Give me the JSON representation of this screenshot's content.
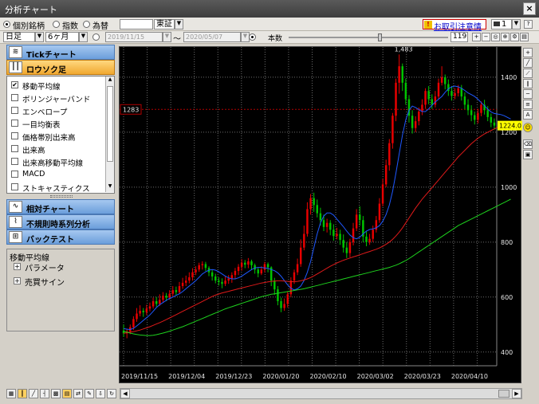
{
  "window": {
    "title": "分析チャート",
    "close_label": "×"
  },
  "toolbar": {
    "type_options": [
      "個別銘柄",
      "指数",
      "為替"
    ],
    "selected_type": "個別銘柄",
    "market": "東証",
    "notice": "お取引注意情報",
    "window_count": "1",
    "period_unit": "日足",
    "period_range": "6ヶ月",
    "date_from": "2019/11/15",
    "date_to": "2020/05/07",
    "tilde": "〜",
    "bars_label": "本数",
    "bars_value": "119"
  },
  "sidebar": {
    "sections": [
      {
        "label": "Tickチャート",
        "icon": "tick-icon"
      },
      {
        "label": "ロウソク足",
        "icon": "candle-icon",
        "active": true
      }
    ],
    "indicators": [
      {
        "label": "移動平均線",
        "checked": true
      },
      {
        "label": "ボリンジャーバンド",
        "checked": false
      },
      {
        "label": "エンベロープ",
        "checked": false
      },
      {
        "label": "一目均衡表",
        "checked": false
      },
      {
        "label": "価格帯別出来高",
        "checked": false
      },
      {
        "label": "出来高",
        "checked": false
      },
      {
        "label": "出来高移動平均線",
        "checked": false
      },
      {
        "label": "MACD",
        "checked": false
      },
      {
        "label": "ストキャスティクス",
        "checked": false
      }
    ],
    "more_sections": [
      {
        "label": "相対チャート",
        "icon": "relative-icon"
      },
      {
        "label": "不規則時系列分析",
        "icon": "irregular-icon"
      },
      {
        "label": "バックテスト",
        "icon": "backtest-icon"
      }
    ],
    "param_panel": {
      "title": "移動平均線",
      "items": [
        "パラメータ",
        "売買サイン"
      ]
    }
  },
  "chart_data": {
    "type": "candlestick",
    "y_ticks": [
      400,
      600,
      800,
      1000,
      1200,
      1400
    ],
    "ylim": [
      350,
      1510
    ],
    "x_labels": [
      "2019/11/15",
      "2019/12/04",
      "2019/12/23",
      "2020/01/20",
      "2020/02/10",
      "2020/03/02",
      "2020/03/23",
      "2020/04/10"
    ],
    "high_marker": "1,483",
    "hline_label": "1283",
    "current_price": "1224.0",
    "candles": [
      [
        478,
        468,
        500,
        455
      ],
      [
        468,
        475,
        485,
        450
      ],
      [
        475,
        490,
        500,
        465
      ],
      [
        490,
        520,
        530,
        480
      ],
      [
        520,
        540,
        560,
        510
      ],
      [
        540,
        550,
        570,
        530
      ],
      [
        550,
        545,
        560,
        528
      ],
      [
        545,
        558,
        572,
        535
      ],
      [
        558,
        566,
        580,
        548
      ],
      [
        566,
        585,
        598,
        558
      ],
      [
        585,
        575,
        600,
        565
      ],
      [
        575,
        590,
        610,
        568
      ],
      [
        590,
        605,
        618,
        580
      ],
      [
        605,
        598,
        615,
        585
      ],
      [
        598,
        612,
        625,
        590
      ],
      [
        612,
        625,
        640,
        600
      ],
      [
        625,
        618,
        638,
        605
      ],
      [
        618,
        640,
        655,
        612
      ],
      [
        640,
        652,
        670,
        630
      ],
      [
        652,
        660,
        678,
        640
      ],
      [
        660,
        672,
        690,
        650
      ],
      [
        672,
        690,
        705,
        660
      ],
      [
        690,
        700,
        712,
        680
      ],
      [
        700,
        716,
        725,
        692
      ],
      [
        716,
        720,
        730,
        700
      ],
      [
        720,
        706,
        728,
        695
      ],
      [
        706,
        690,
        712,
        676
      ],
      [
        690,
        675,
        700,
        660
      ],
      [
        675,
        660,
        685,
        650
      ],
      [
        660,
        655,
        672,
        642
      ],
      [
        655,
        648,
        668,
        632
      ],
      [
        648,
        660,
        675,
        640
      ],
      [
        660,
        668,
        680,
        648
      ],
      [
        668,
        680,
        690,
        652
      ],
      [
        680,
        695,
        706,
        665
      ],
      [
        695,
        710,
        720,
        680
      ],
      [
        710,
        725,
        738,
        696
      ],
      [
        725,
        718,
        735,
        705
      ],
      [
        718,
        730,
        742,
        705
      ],
      [
        730,
        716,
        736,
        698
      ],
      [
        716,
        700,
        722,
        685
      ],
      [
        700,
        686,
        708,
        672
      ],
      [
        686,
        700,
        712,
        680
      ],
      [
        700,
        720,
        728,
        690
      ],
      [
        720,
        708,
        726,
        690
      ],
      [
        708,
        660,
        712,
        640
      ],
      [
        660,
        628,
        670,
        608
      ],
      [
        628,
        585,
        640,
        570
      ],
      [
        585,
        560,
        598,
        545
      ],
      [
        560,
        575,
        595,
        550
      ],
      [
        575,
        610,
        620,
        562
      ],
      [
        610,
        660,
        672,
        600
      ],
      [
        660,
        690,
        700,
        648
      ],
      [
        690,
        720,
        740,
        680
      ],
      [
        720,
        780,
        810,
        710
      ],
      [
        780,
        830,
        860,
        770
      ],
      [
        830,
        920,
        945,
        820
      ],
      [
        920,
        960,
        975,
        900
      ],
      [
        960,
        935,
        980,
        910
      ],
      [
        935,
        905,
        955,
        890
      ],
      [
        905,
        880,
        925,
        860
      ],
      [
        880,
        855,
        900,
        840
      ],
      [
        855,
        870,
        885,
        835
      ],
      [
        870,
        845,
        880,
        825
      ],
      [
        845,
        822,
        865,
        805
      ],
      [
        822,
        830,
        852,
        810
      ],
      [
        830,
        808,
        845,
        790
      ],
      [
        808,
        780,
        828,
        762
      ],
      [
        780,
        760,
        800,
        742
      ],
      [
        760,
        800,
        812,
        745
      ],
      [
        800,
        850,
        870,
        788
      ],
      [
        850,
        900,
        920,
        840
      ],
      [
        900,
        880,
        930,
        860
      ],
      [
        880,
        820,
        895,
        800
      ],
      [
        820,
        800,
        840,
        785
      ],
      [
        800,
        812,
        830,
        790
      ],
      [
        812,
        845,
        860,
        800
      ],
      [
        845,
        880,
        895,
        835
      ],
      [
        880,
        940,
        960,
        870
      ],
      [
        940,
        1010,
        1030,
        930
      ],
      [
        1010,
        1080,
        1100,
        1000
      ],
      [
        1080,
        1160,
        1175,
        1060
      ],
      [
        1160,
        1260,
        1270,
        1140
      ],
      [
        1260,
        1380,
        1395,
        1240
      ],
      [
        1380,
        1440,
        1483,
        1340
      ],
      [
        1440,
        1380,
        1450,
        1350
      ],
      [
        1380,
        1320,
        1395,
        1300
      ],
      [
        1320,
        1260,
        1335,
        1235
      ],
      [
        1260,
        1215,
        1280,
        1195
      ],
      [
        1215,
        1240,
        1258,
        1200
      ],
      [
        1240,
        1275,
        1290,
        1225
      ],
      [
        1275,
        1300,
        1320,
        1262
      ],
      [
        1300,
        1350,
        1360,
        1285
      ],
      [
        1350,
        1320,
        1368,
        1302
      ],
      [
        1320,
        1300,
        1338,
        1285
      ],
      [
        1300,
        1330,
        1350,
        1290
      ],
      [
        1330,
        1380,
        1395,
        1318
      ],
      [
        1380,
        1400,
        1440,
        1370
      ],
      [
        1400,
        1375,
        1410,
        1356
      ],
      [
        1375,
        1350,
        1392,
        1332
      ],
      [
        1350,
        1332,
        1368,
        1315
      ],
      [
        1332,
        1342,
        1360,
        1320
      ],
      [
        1342,
        1360,
        1372,
        1330
      ],
      [
        1360,
        1330,
        1372,
        1315
      ],
      [
        1330,
        1300,
        1345,
        1284
      ],
      [
        1300,
        1280,
        1320,
        1262
      ],
      [
        1280,
        1262,
        1298,
        1240
      ],
      [
        1262,
        1245,
        1275,
        1228
      ],
      [
        1245,
        1270,
        1285,
        1232
      ],
      [
        1270,
        1300,
        1312,
        1258
      ],
      [
        1300,
        1280,
        1318,
        1264
      ],
      [
        1280,
        1255,
        1295,
        1240
      ],
      [
        1255,
        1235,
        1268,
        1218
      ],
      [
        1235,
        1224,
        1250,
        1210
      ]
    ],
    "series": [
      {
        "color": "#1e58ff",
        "values": [
          485,
          483,
          482,
          486,
          495,
          505,
          515,
          525,
          535,
          548,
          562,
          572,
          580,
          588,
          595,
          600,
          606,
          612,
          620,
          630,
          640,
          650,
          660,
          672,
          684,
          692,
          698,
          700,
          698,
          692,
          684,
          676,
          670,
          666,
          666,
          670,
          676,
          684,
          692,
          700,
          706,
          708,
          708,
          706,
          704,
          700,
          696,
          688,
          676,
          660,
          644,
          632,
          626,
          630,
          640,
          660,
          690,
          730,
          780,
          830,
          870,
          895,
          906,
          906,
          898,
          884,
          870,
          856,
          840,
          826,
          816,
          812,
          818,
          830,
          840,
          846,
          848,
          852,
          860,
          876,
          900,
          935,
          985,
          1050,
          1120,
          1190,
          1245,
          1280,
          1295,
          1290,
          1282,
          1275,
          1275,
          1285,
          1298,
          1310,
          1320,
          1330,
          1345,
          1358,
          1365,
          1368,
          1365,
          1360,
          1352,
          1343,
          1337,
          1330,
          1320,
          1308,
          1296,
          1284,
          1274,
          1268,
          1266,
          1264,
          1260,
          1254,
          1248
        ]
      },
      {
        "color": "#e01a1a",
        "values": [
          468,
          470,
          472,
          474,
          477,
          480,
          484,
          488,
          492,
          497,
          502,
          507,
          512,
          518,
          524,
          530,
          536,
          542,
          548,
          554,
          560,
          566,
          572,
          578,
          584,
          590,
          596,
          602,
          607,
          611,
          615,
          618,
          621,
          624,
          627,
          630,
          633,
          636,
          639,
          642,
          645,
          648,
          651,
          653,
          655,
          657,
          658,
          659,
          659,
          658,
          657,
          656,
          656,
          657,
          659,
          662,
          666,
          671,
          677,
          684,
          691,
          698,
          705,
          712,
          718,
          724,
          729,
          734,
          738,
          742,
          746,
          750,
          754,
          758,
          762,
          766,
          770,
          774,
          779,
          785,
          792,
          800,
          810,
          822,
          836,
          852,
          870,
          888,
          906,
          924,
          940,
          956,
          970,
          984,
          998,
          1012,
          1026,
          1040,
          1054,
          1068,
          1082,
          1096,
          1110,
          1122,
          1134,
          1146,
          1158,
          1168,
          1178,
          1186,
          1194,
          1200,
          1206,
          1212,
          1217,
          1222,
          1226,
          1230,
          1233
        ]
      },
      {
        "color": "#1ed21e",
        "values": [
          475,
          472,
          469,
          466,
          464,
          462,
          461,
          460,
          460,
          461,
          463,
          466,
          469,
          472,
          476,
          480,
          484,
          488,
          492,
          497,
          502,
          507,
          512,
          517,
          522,
          527,
          532,
          537,
          542,
          547,
          552,
          557,
          561,
          565,
          569,
          573,
          577,
          581,
          585,
          589,
          593,
          597,
          601,
          604,
          607,
          610,
          612,
          614,
          616,
          618,
          620,
          622,
          624,
          626,
          628,
          630,
          633,
          636,
          639,
          642,
          645,
          648,
          651,
          654,
          657,
          660,
          663,
          666,
          669,
          672,
          675,
          678,
          681,
          684,
          687,
          690,
          693,
          696,
          699,
          702,
          705,
          708,
          712,
          716,
          721,
          727,
          733,
          740,
          748,
          756,
          764,
          772,
          780,
          788,
          796,
          804,
          812,
          820,
          828,
          836,
          844,
          852,
          860,
          866,
          872,
          878,
          884,
          890,
          896,
          902,
          908,
          914,
          920,
          926,
          932,
          938,
          944,
          950,
          956
        ]
      }
    ]
  },
  "colors": {
    "up": "#e80000",
    "down": "#00c400",
    "grid": "#6b6b6b",
    "axis_text": "#e6e6e6",
    "hline": "#b00000"
  }
}
